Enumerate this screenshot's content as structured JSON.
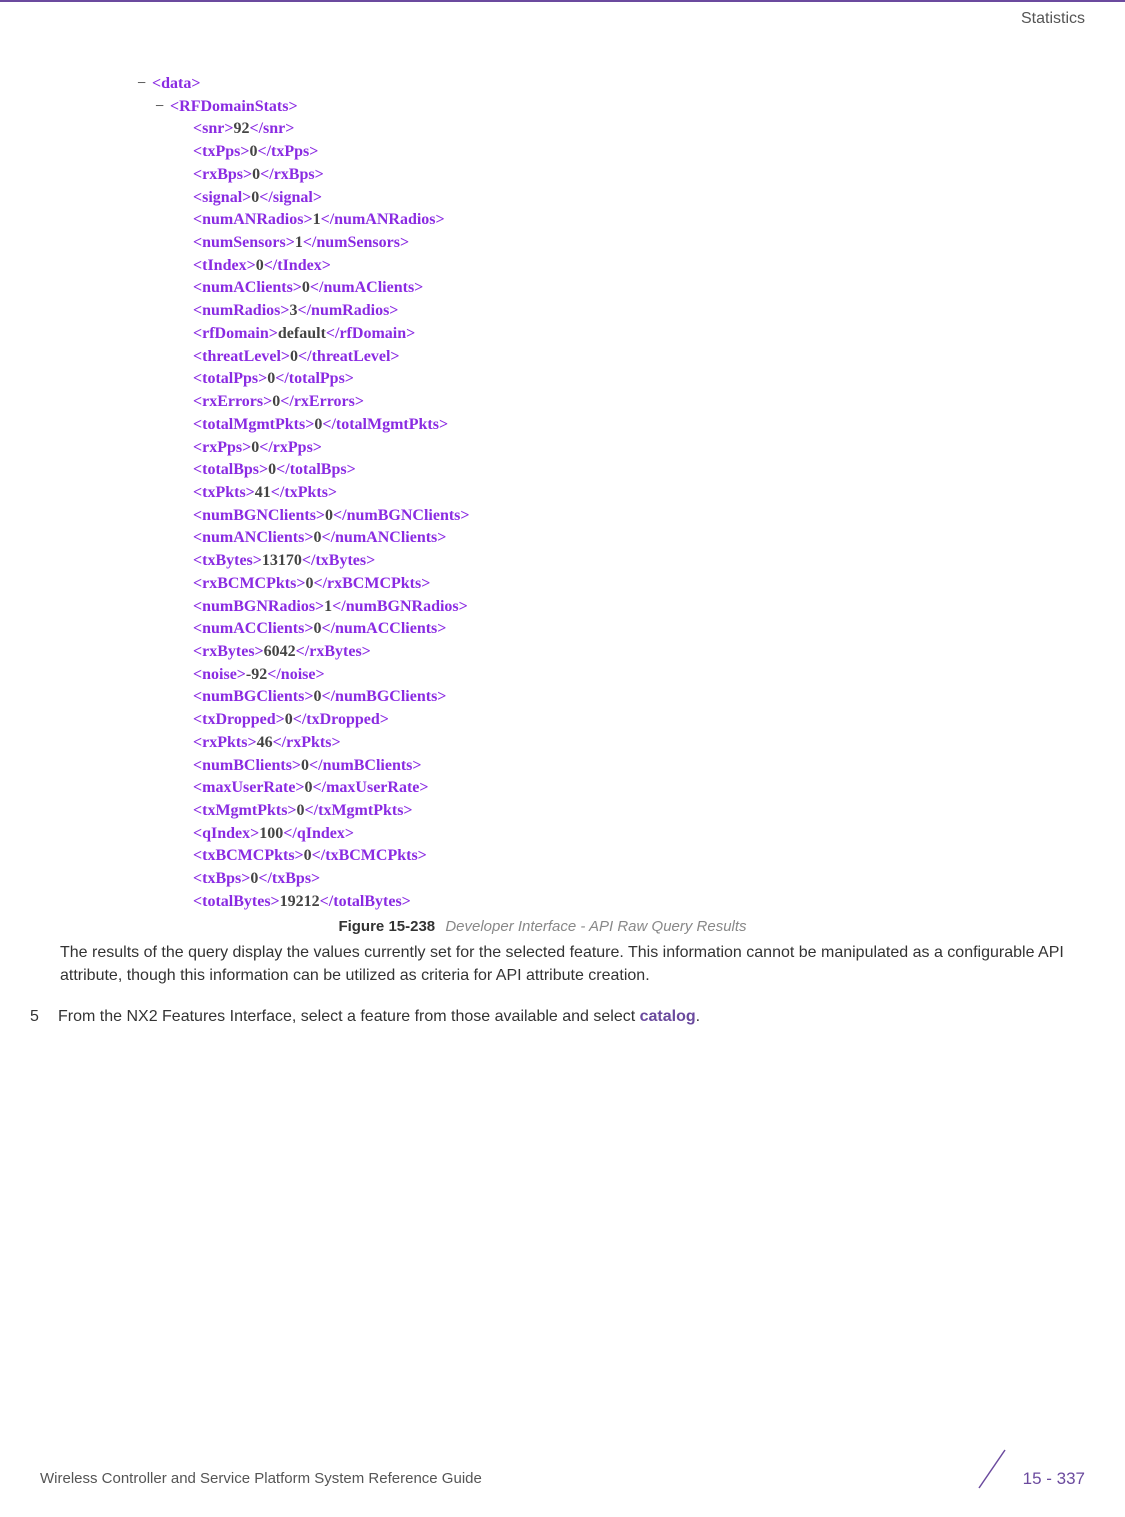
{
  "header": {
    "section": "Statistics"
  },
  "xml": {
    "root_open": "<data>",
    "child_open": "<RFDomainStats>",
    "entries": [
      {
        "tag": "snr",
        "value": "92"
      },
      {
        "tag": "txPps",
        "value": "0"
      },
      {
        "tag": "rxBps",
        "value": "0"
      },
      {
        "tag": "signal",
        "value": "0"
      },
      {
        "tag": "numANRadios",
        "value": "1"
      },
      {
        "tag": "numSensors",
        "value": "1"
      },
      {
        "tag": "tIndex",
        "value": "0"
      },
      {
        "tag": "numAClients",
        "value": "0"
      },
      {
        "tag": "numRadios",
        "value": "3"
      },
      {
        "tag": "rfDomain",
        "value": "default"
      },
      {
        "tag": "threatLevel",
        "value": "0"
      },
      {
        "tag": "totalPps",
        "value": "0"
      },
      {
        "tag": "rxErrors",
        "value": "0"
      },
      {
        "tag": "totalMgmtPkts",
        "value": "0"
      },
      {
        "tag": "rxPps",
        "value": "0"
      },
      {
        "tag": "totalBps",
        "value": "0"
      },
      {
        "tag": "txPkts",
        "value": "41"
      },
      {
        "tag": "numBGNClients",
        "value": "0"
      },
      {
        "tag": "numANClients",
        "value": "0"
      },
      {
        "tag": "txBytes",
        "value": "13170"
      },
      {
        "tag": "rxBCMCPkts",
        "value": "0"
      },
      {
        "tag": "numBGNRadios",
        "value": "1"
      },
      {
        "tag": "numACClients",
        "value": "0"
      },
      {
        "tag": "rxBytes",
        "value": "6042"
      },
      {
        "tag": "noise",
        "value": "-92"
      },
      {
        "tag": "numBGClients",
        "value": "0"
      },
      {
        "tag": "txDropped",
        "value": "0"
      },
      {
        "tag": "rxPkts",
        "value": "46"
      },
      {
        "tag": "numBClients",
        "value": "0"
      },
      {
        "tag": "maxUserRate",
        "value": "0"
      },
      {
        "tag": "txMgmtPkts",
        "value": "0"
      },
      {
        "tag": "qIndex",
        "value": "100"
      },
      {
        "tag": "txBCMCPkts",
        "value": "0"
      },
      {
        "tag": "txBps",
        "value": "0"
      },
      {
        "tag": "totalBytes",
        "value": "19212"
      }
    ]
  },
  "figure": {
    "label": "Figure 15-238",
    "desc": "Developer Interface - API Raw Query Results"
  },
  "body": {
    "para": "The results of the query display the values currently set for the selected feature. This information cannot be manipulated as a configurable API attribute, though this information can be utilized as criteria for API attribute creation."
  },
  "step": {
    "num": "5",
    "text_before": "From the NX2 Features Interface, select a feature from those available and select ",
    "keyword": "catalog",
    "text_after": "."
  },
  "footer": {
    "left": "Wireless Controller and Service Platform System Reference Guide",
    "right": "15 - 337"
  }
}
